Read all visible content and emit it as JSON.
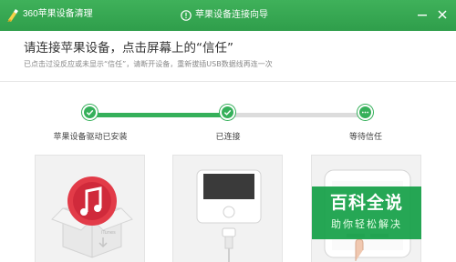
{
  "window": {
    "app_title": "360苹果设备清理",
    "wizard_title": "苹果设备连接向导",
    "theme_color": "#35b05a"
  },
  "instruction": {
    "title": "请连接苹果设备，点击屏幕上的“信任”",
    "subtitle": "已点击过没反应或未显示“信任”，请断开设备，重新拔插USB数据线再连一次"
  },
  "steps": [
    {
      "label": "苹果设备驱动已安装",
      "status": "done",
      "icon": "check-icon"
    },
    {
      "label": "已连接",
      "status": "done",
      "icon": "check-icon"
    },
    {
      "label": "等待信任",
      "status": "waiting",
      "icon": "ellipsis-icon"
    }
  ],
  "cards": [
    {
      "name": "itunes-driver-illustration",
      "box_label": "iTunes"
    },
    {
      "name": "iphone-cable-illustration"
    },
    {
      "name": "trust-dialog-illustration"
    }
  ],
  "watermark": {
    "title": "百科全说",
    "subtitle": "助你轻松解决"
  }
}
